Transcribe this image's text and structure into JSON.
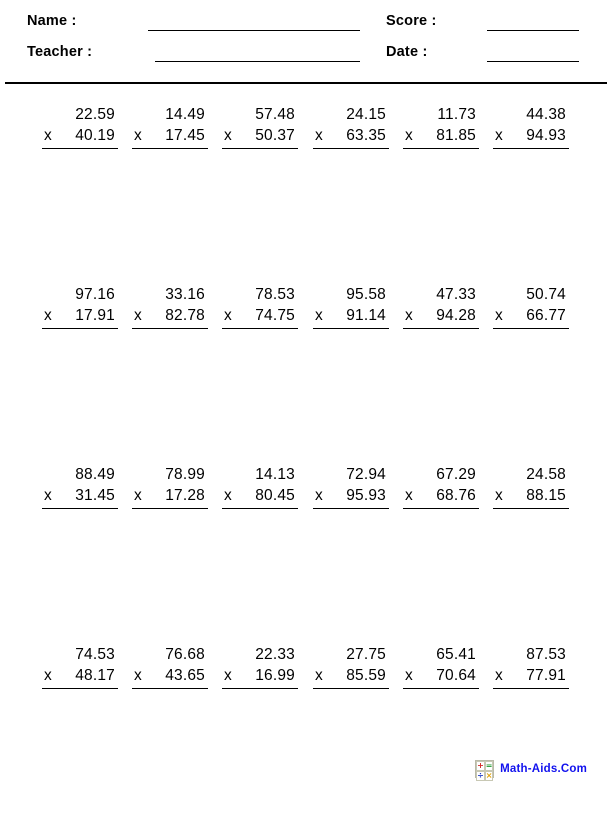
{
  "header": {
    "name_label": "Name :",
    "teacher_label": "Teacher :",
    "score_label": "Score :",
    "date_label": "Date :",
    "name_value": "",
    "teacher_value": "",
    "score_value": "",
    "date_value": ""
  },
  "worksheet": {
    "operator": "x",
    "columns": 6,
    "rows": 4,
    "problems": [
      [
        {
          "top": "22.59",
          "bottom": "40.19"
        },
        {
          "top": "14.49",
          "bottom": "17.45"
        },
        {
          "top": "57.48",
          "bottom": "50.37"
        },
        {
          "top": "24.15",
          "bottom": "63.35"
        },
        {
          "top": "11.73",
          "bottom": "81.85"
        },
        {
          "top": "44.38",
          "bottom": "94.93"
        }
      ],
      [
        {
          "top": "97.16",
          "bottom": "17.91"
        },
        {
          "top": "33.16",
          "bottom": "82.78"
        },
        {
          "top": "78.53",
          "bottom": "74.75"
        },
        {
          "top": "95.58",
          "bottom": "91.14"
        },
        {
          "top": "47.33",
          "bottom": "94.28"
        },
        {
          "top": "50.74",
          "bottom": "66.77"
        }
      ],
      [
        {
          "top": "88.49",
          "bottom": "31.45"
        },
        {
          "top": "78.99",
          "bottom": "17.28"
        },
        {
          "top": "14.13",
          "bottom": "80.45"
        },
        {
          "top": "72.94",
          "bottom": "95.93"
        },
        {
          "top": "67.29",
          "bottom": "68.76"
        },
        {
          "top": "24.58",
          "bottom": "88.15"
        }
      ],
      [
        {
          "top": "74.53",
          "bottom": "48.17"
        },
        {
          "top": "76.68",
          "bottom": "43.65"
        },
        {
          "top": "22.33",
          "bottom": "16.99"
        },
        {
          "top": "27.75",
          "bottom": "85.59"
        },
        {
          "top": "65.41",
          "bottom": "70.64"
        },
        {
          "top": "87.53",
          "bottom": "77.91"
        }
      ]
    ]
  },
  "footer": {
    "site_text": "Math-Aids.Com",
    "site_color": "#1111ee",
    "icon_glyphs": {
      "plus": "+",
      "equals": "=",
      "divide": "÷",
      "times": "×"
    }
  }
}
